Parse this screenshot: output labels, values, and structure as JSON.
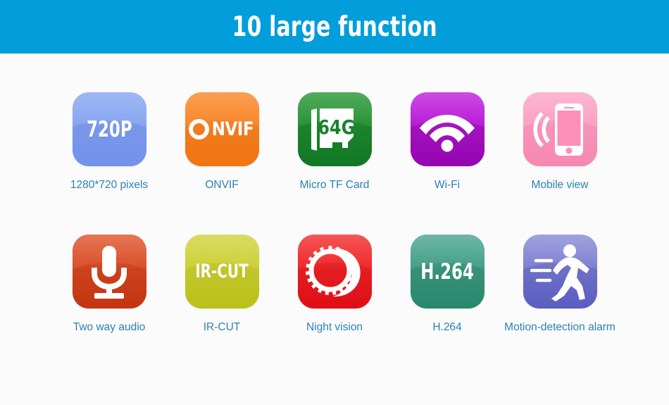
{
  "header": {
    "title": "10 large function",
    "background_color": "#029ddb",
    "text_color": "#ffffff"
  },
  "theme": {
    "page_background": "#fbfbfb",
    "caption_color": "#2b82b5"
  },
  "features": [
    {
      "id": "resolution",
      "tile_text": "720P",
      "caption": "1280*720 pixels",
      "icon": "text-720p-icon",
      "color": "#7e9cf0"
    },
    {
      "id": "onvif",
      "tile_text": "Onvif",
      "tile_word": "NVIF",
      "caption": "ONVIF",
      "icon": "onvif-logo-icon",
      "color": "#f97a12"
    },
    {
      "id": "tf-card",
      "tile_text": "64G",
      "caption": "Micro TF Card",
      "icon": "microsd-card-icon",
      "color": "#14822a"
    },
    {
      "id": "wifi",
      "tile_text": "",
      "caption": "Wi-Fi",
      "icon": "wifi-icon",
      "color": "#a507c2"
    },
    {
      "id": "mobile-view",
      "tile_text": "",
      "caption": "Mobile view",
      "icon": "mobile-phone-icon",
      "color": "#fb8fb8"
    },
    {
      "id": "two-way-audio",
      "tile_text": "",
      "caption": "Two way audio",
      "icon": "microphone-icon",
      "color": "#ce3a14"
    },
    {
      "id": "ir-cut",
      "tile_text": "IR-CUT",
      "caption": "IR-CUT",
      "icon": "text-ircut-icon",
      "color": "#c3ca1c"
    },
    {
      "id": "night-vision",
      "tile_text": "",
      "caption": "Night vision",
      "icon": "sun-moon-icon",
      "color": "#ec0f17"
    },
    {
      "id": "h264",
      "tile_text": "H.264",
      "caption": "H.264",
      "icon": "text-h264-icon",
      "color": "#2f9175"
    },
    {
      "id": "motion-detection",
      "tile_text": "",
      "caption": "Motion-detection alarm",
      "icon": "running-person-icon",
      "color": "#6467c9"
    }
  ]
}
